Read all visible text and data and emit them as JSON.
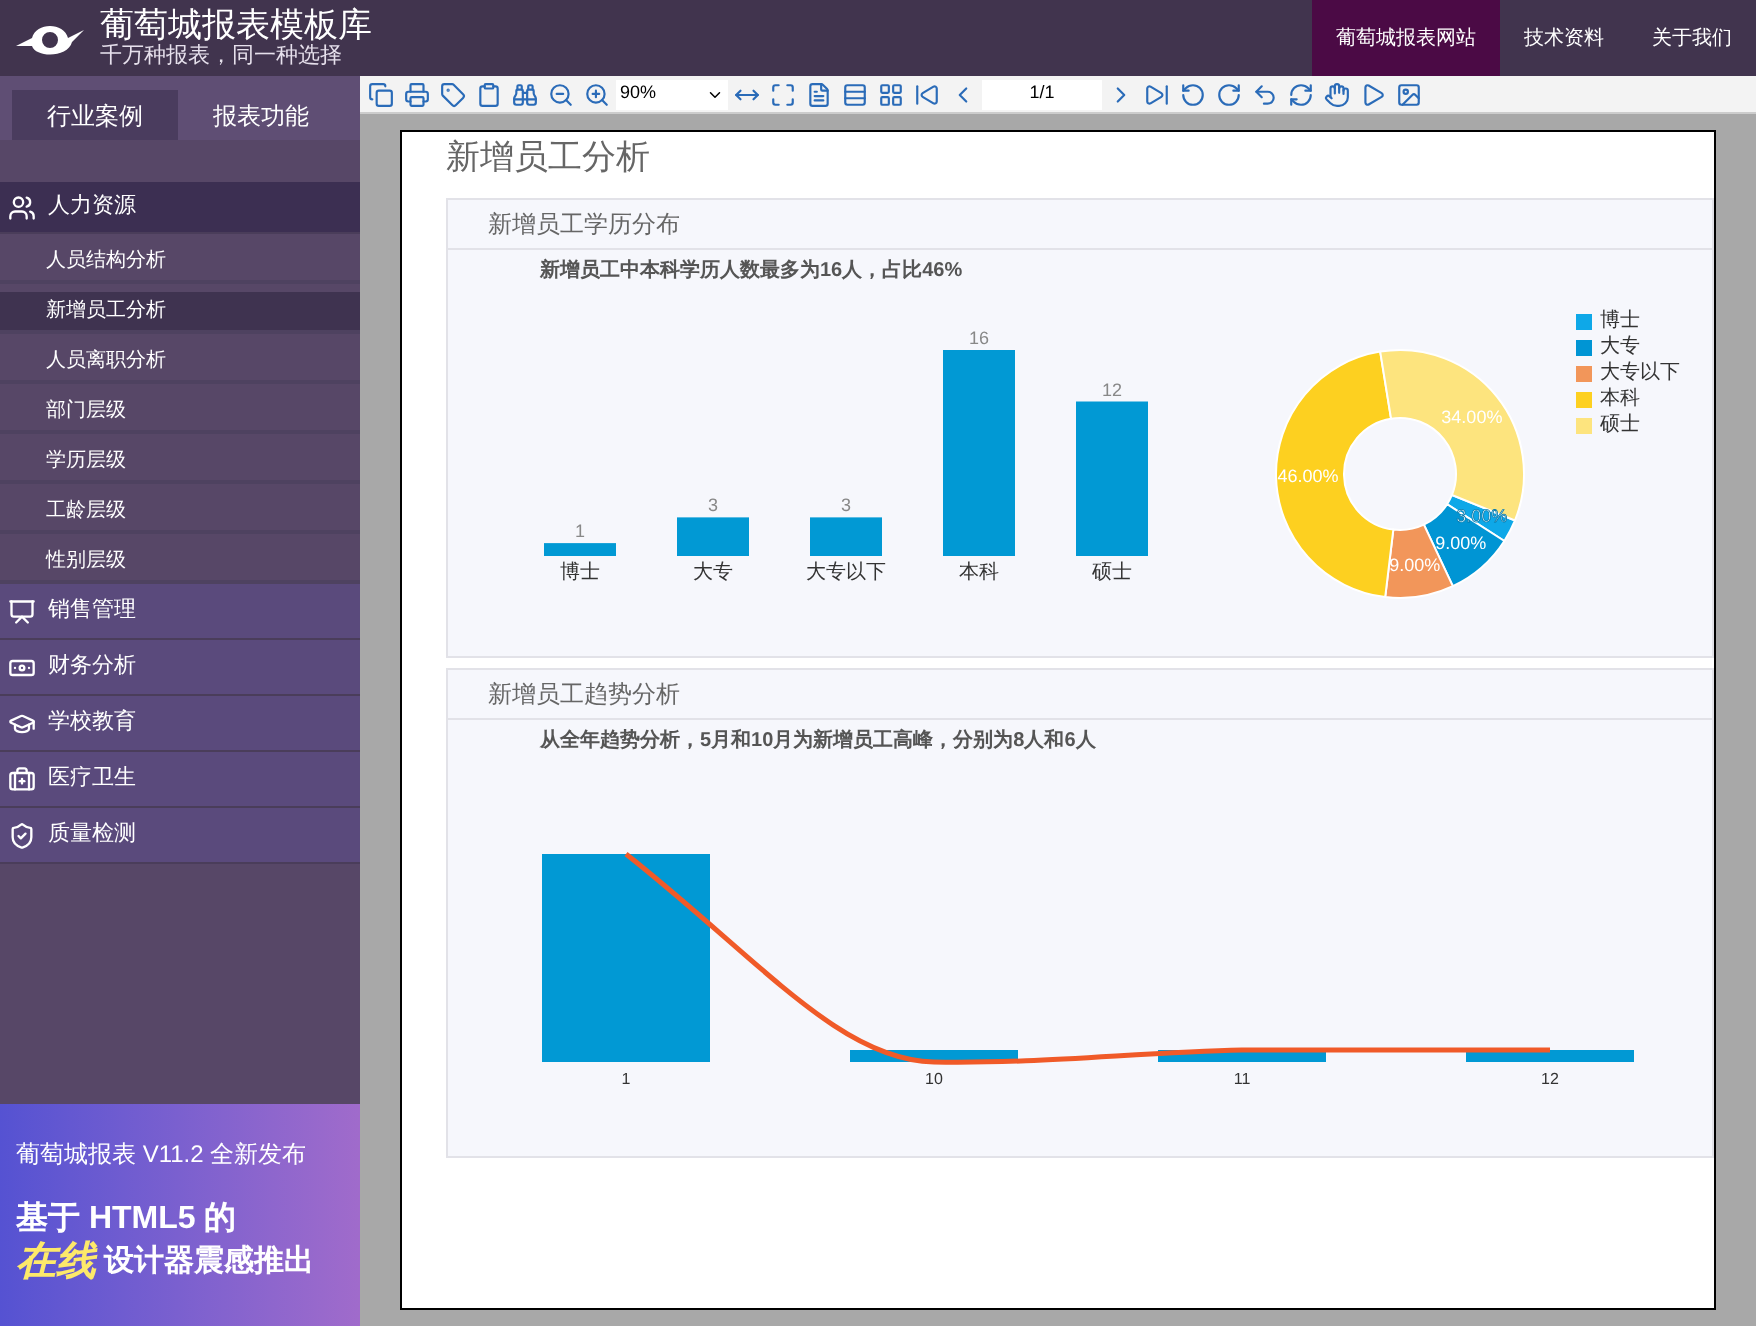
{
  "header": {
    "title": "葡萄城报表模板库",
    "subtitle": "千万种报表，同一种选择",
    "nav": [
      {
        "label": "葡萄城报表网站",
        "selected": true
      },
      {
        "label": "技术资料",
        "selected": false
      },
      {
        "label": "关于我们",
        "selected": false
      }
    ]
  },
  "sidebar": {
    "tabs": [
      {
        "label": "行业案例",
        "selected": true
      },
      {
        "label": "报表功能",
        "selected": false
      }
    ],
    "menu": [
      {
        "label": "人力资源",
        "expanded": true,
        "children": [
          {
            "label": "人员结构分析",
            "selected": false
          },
          {
            "label": "新增员工分析",
            "selected": true
          },
          {
            "label": "人员离职分析",
            "selected": false
          },
          {
            "label": "部门层级",
            "selected": false
          },
          {
            "label": "学历层级",
            "selected": false
          },
          {
            "label": "工龄层级",
            "selected": false
          },
          {
            "label": "性别层级",
            "selected": false
          }
        ]
      },
      {
        "label": "销售管理",
        "expanded": false
      },
      {
        "label": "财务分析",
        "expanded": false
      },
      {
        "label": "学校教育",
        "expanded": false
      },
      {
        "label": "医疗卫生",
        "expanded": false
      },
      {
        "label": "质量检测",
        "expanded": false
      }
    ],
    "banner": {
      "line1": "葡萄城报表 V11.2 全新发布",
      "line2": "基于 HTML5 的",
      "highlight": "在线",
      "line3": "设计器震感推出"
    }
  },
  "toolbar": {
    "zoom": "90%",
    "page": "1/1"
  },
  "report": {
    "title": "新增员工分析",
    "education": {
      "title": "新增员工学历分布",
      "summary": "新增员工中本科学历人数最多为16人，占比46%",
      "chart_data": {
        "type": "bar",
        "categories": [
          "博士",
          "大专",
          "大专以下",
          "本科",
          "硕士"
        ],
        "values": [
          1,
          3,
          3,
          16,
          12
        ],
        "data_labels": true
      },
      "donut": {
        "chart_data": {
          "type": "donut",
          "categories": [
            "博士",
            "大专",
            "大专以下",
            "本科",
            "硕士"
          ],
          "value_labels": [
            "3.00%",
            "9.00%",
            "9.00%",
            "46.00%",
            "34.00%"
          ],
          "values": [
            3,
            9,
            9,
            46,
            34
          ],
          "colors": [
            "#0ea8e8",
            "#0095d4",
            "#f2965a",
            "#fdd020",
            "#fde47e"
          ]
        }
      }
    },
    "trend": {
      "title": "新增员工趋势分析",
      "summary": "从全年趋势分析，5月和10月为新增员工高峰，分别为8人和6人",
      "x_labels": [
        "1",
        "10",
        "11",
        "12"
      ]
    }
  }
}
